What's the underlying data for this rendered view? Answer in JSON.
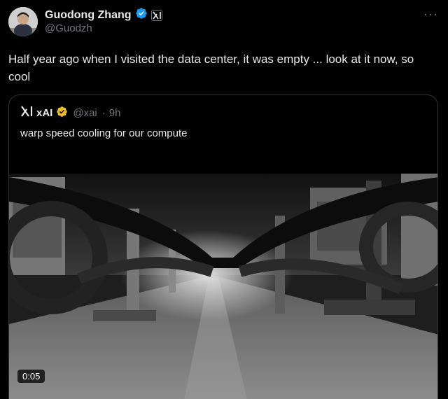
{
  "post": {
    "author": {
      "name": "Guodong Zhang",
      "handle": "@Guodzh"
    },
    "text": "Half year ago when I visited the data center, it was empty ... look at it now, so cool",
    "more_icon": "more-horizontal-icon"
  },
  "quoted_post": {
    "author_name": "xAI",
    "handle": "@xai",
    "time": "9h",
    "text": "warp speed cooling for our compute",
    "video": {
      "timestamp": "0:05"
    }
  },
  "colors": {
    "verified_blue": "#1d9bf0",
    "verified_gold": "#e8b931",
    "secondary_text": "#71767b",
    "border": "#2f3336"
  }
}
